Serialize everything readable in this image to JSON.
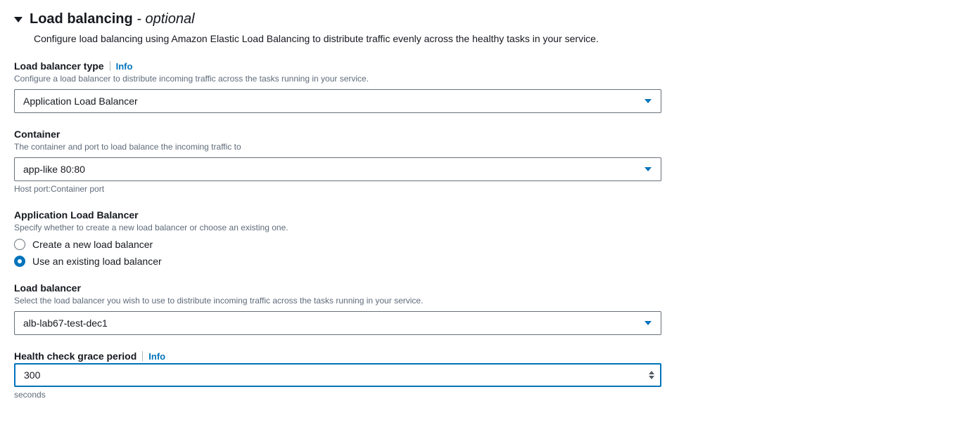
{
  "section": {
    "title": "Load balancing",
    "optional_suffix": " - optional",
    "description": "Configure load balancing using Amazon Elastic Load Balancing to distribute traffic evenly across the healthy tasks in your service."
  },
  "lb_type": {
    "label": "Load balancer type",
    "info": "Info",
    "description": "Configure a load balancer to distribute incoming traffic across the tasks running in your service.",
    "value": "Application Load Balancer"
  },
  "container": {
    "label": "Container",
    "description": "The container and port to load balance the incoming traffic to",
    "value": "app-like 80:80",
    "hint": "Host port:Container port"
  },
  "alb": {
    "label": "Application Load Balancer",
    "description": "Specify whether to create a new load balancer or choose an existing one.",
    "options": [
      {
        "label": "Create a new load balancer",
        "checked": false
      },
      {
        "label": "Use an existing load balancer",
        "checked": true
      }
    ]
  },
  "lb_select": {
    "label": "Load balancer",
    "description": "Select the load balancer you wish to use to distribute incoming traffic across the tasks running in your service.",
    "value": "alb-lab67-test-dec1"
  },
  "grace": {
    "label": "Health check grace period",
    "info": "Info",
    "value": "300",
    "unit": "seconds"
  }
}
